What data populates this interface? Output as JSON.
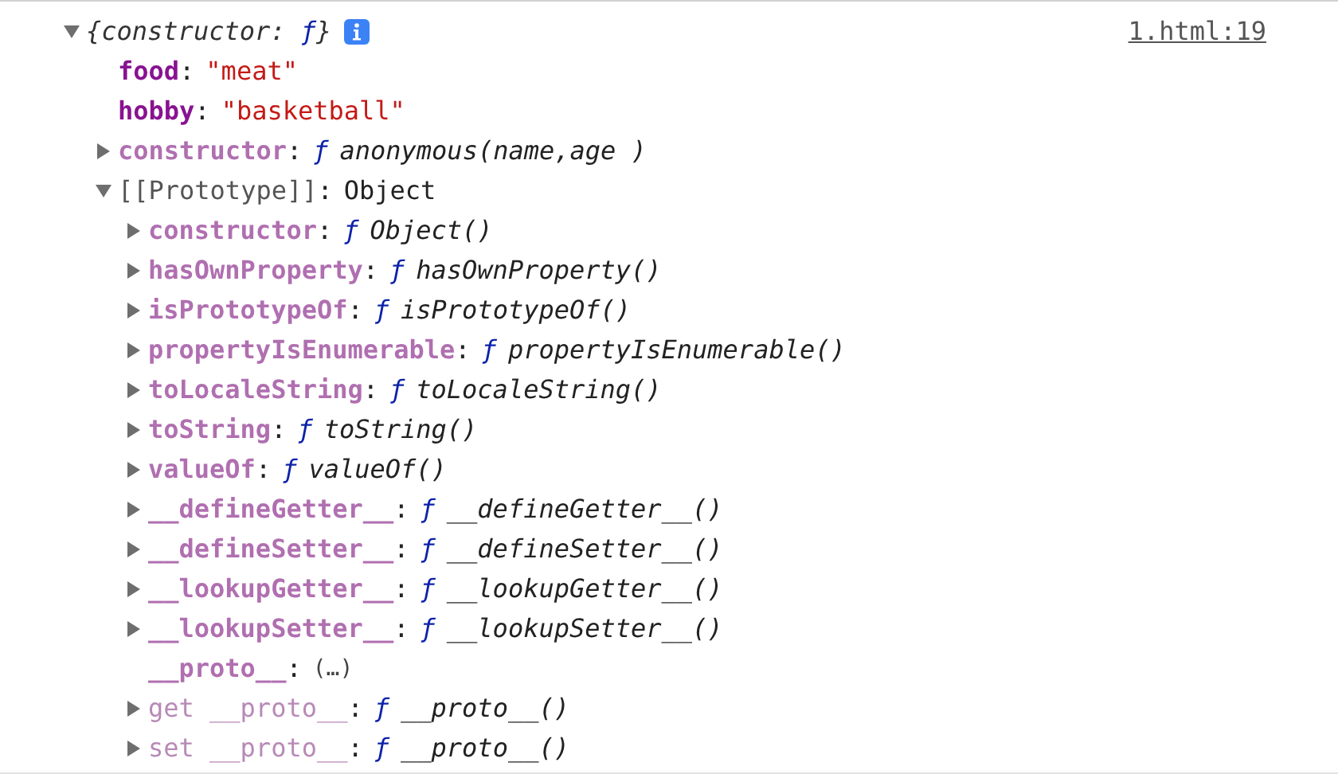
{
  "log_entry": {
    "summary": {
      "open": "{",
      "key": "constructor",
      "sep": ": ",
      "fn": "ƒ",
      "close": "}"
    },
    "expanded": true,
    "source": "1.html:19",
    "children": [
      {
        "kind": "field",
        "key": "food",
        "colon": ":",
        "value": "\"meat\""
      },
      {
        "kind": "field",
        "key": "hobby",
        "colon": ":",
        "value": "\"basketball\""
      },
      {
        "kind": "method",
        "key": "constructor",
        "colon": ":",
        "fn": "ƒ",
        "value": "anonymous(name,age )",
        "expanded": false
      },
      {
        "kind": "prototype",
        "key": "[[Prototype]]",
        "colon": ":",
        "value": "Object",
        "expanded": true,
        "children": [
          {
            "kind": "method",
            "key": "constructor",
            "colon": ":",
            "fn": "ƒ",
            "value": "Object()",
            "expanded": false
          },
          {
            "kind": "method",
            "key": "hasOwnProperty",
            "colon": ":",
            "fn": "ƒ",
            "value": "hasOwnProperty()",
            "expanded": false
          },
          {
            "kind": "method",
            "key": "isPrototypeOf",
            "colon": ":",
            "fn": "ƒ",
            "value": "isPrototypeOf()",
            "expanded": false
          },
          {
            "kind": "method",
            "key": "propertyIsEnumerable",
            "colon": ":",
            "fn": "ƒ",
            "value": "propertyIsEnumerable()",
            "expanded": false
          },
          {
            "kind": "method",
            "key": "toLocaleString",
            "colon": ":",
            "fn": "ƒ",
            "value": "toLocaleString()",
            "expanded": false
          },
          {
            "kind": "method",
            "key": "toString",
            "colon": ":",
            "fn": "ƒ",
            "value": "toString()",
            "expanded": false
          },
          {
            "kind": "method",
            "key": "valueOf",
            "colon": ":",
            "fn": "ƒ",
            "value": "valueOf()",
            "expanded": false
          },
          {
            "kind": "method",
            "key": "__defineGetter__",
            "colon": ":",
            "fn": "ƒ",
            "value": "__defineGetter__()",
            "expanded": false
          },
          {
            "kind": "method",
            "key": "__defineSetter__",
            "colon": ":",
            "fn": "ƒ",
            "value": "__defineSetter__()",
            "expanded": false
          },
          {
            "kind": "method",
            "key": "__lookupGetter__",
            "colon": ":",
            "fn": "ƒ",
            "value": "__lookupGetter__()",
            "expanded": false
          },
          {
            "kind": "method",
            "key": "__lookupSetter__",
            "colon": ":",
            "fn": "ƒ",
            "value": "__lookupSetter__()",
            "expanded": false
          },
          {
            "kind": "lazy",
            "key": "__proto__",
            "colon": ":",
            "value": "(…)"
          },
          {
            "kind": "accessor",
            "key": "get __proto__",
            "colon": ":",
            "fn": "ƒ",
            "value": "__proto__()",
            "expanded": false
          },
          {
            "kind": "accessor",
            "key": "set __proto__",
            "colon": ":",
            "fn": "ƒ",
            "value": "__proto__()",
            "expanded": false
          }
        ]
      }
    ]
  }
}
